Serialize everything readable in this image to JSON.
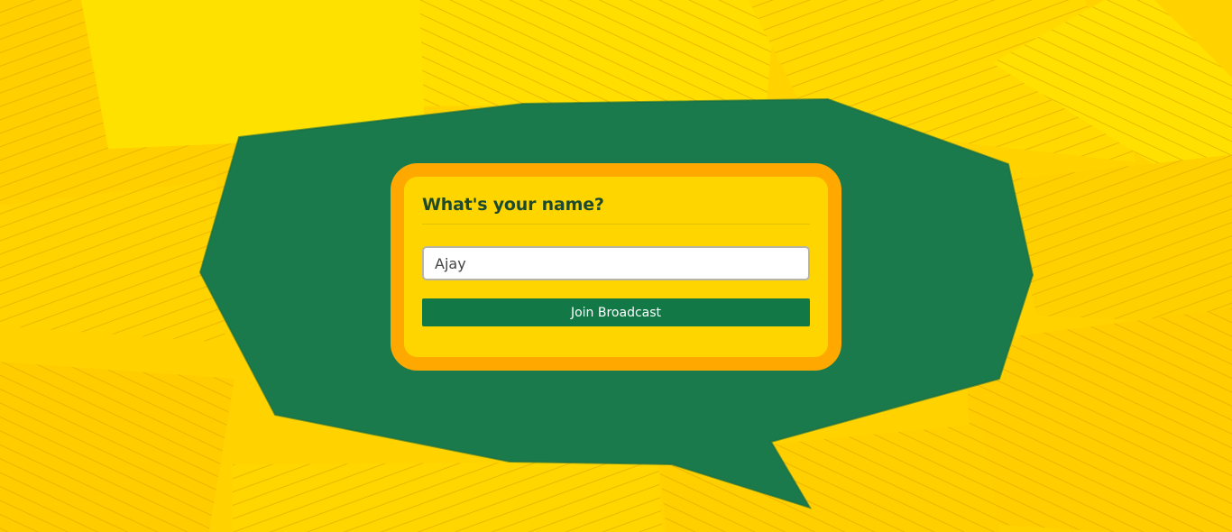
{
  "background": {
    "paper_color": "#ffd400",
    "bubble_color": "#1b7a4c"
  },
  "dialog": {
    "title": "What's your name?",
    "name_value": "Ajay",
    "join_label": "Join Broadcast",
    "accent": "#ffa800",
    "button_color": "#127846"
  }
}
